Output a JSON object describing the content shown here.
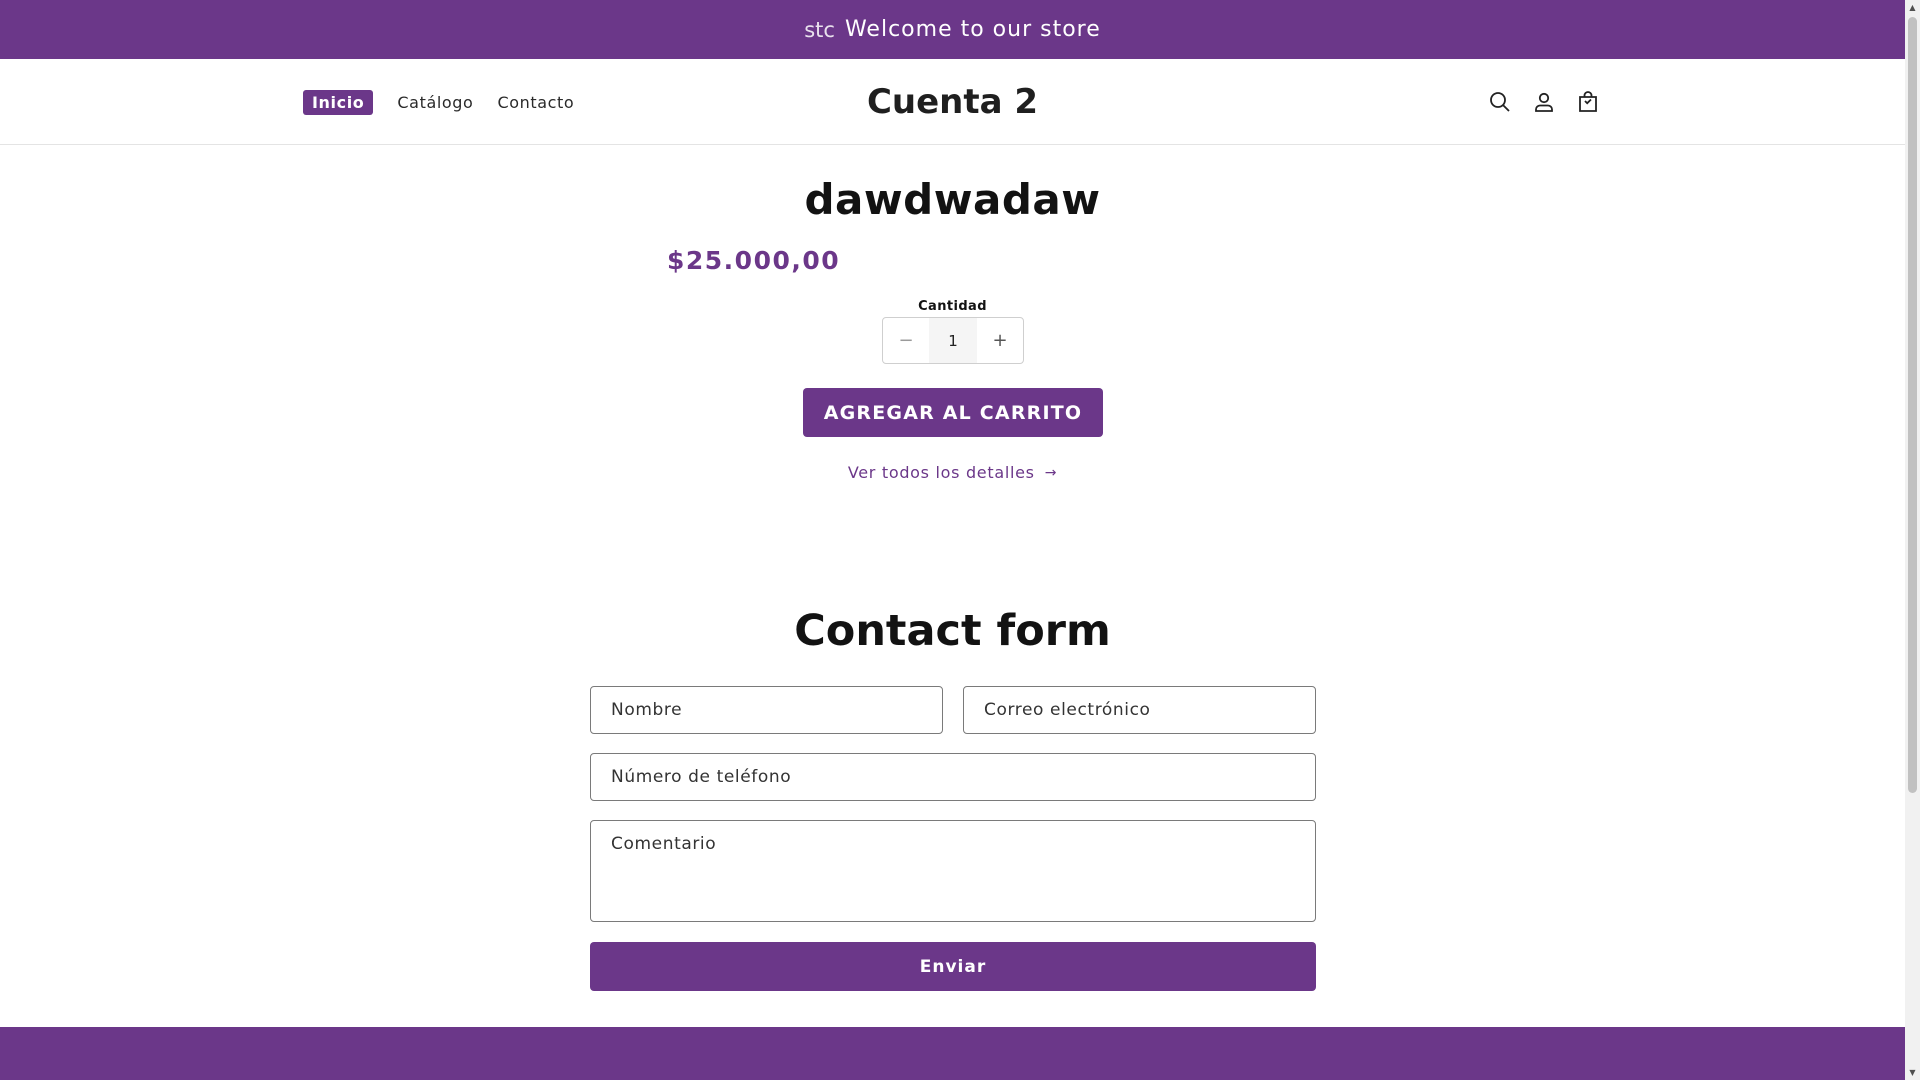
{
  "announcement": {
    "ghost_text": "stc",
    "text": "Welcome to our store"
  },
  "header": {
    "nav": [
      {
        "label": "Inicio"
      },
      {
        "label": "Catálogo"
      },
      {
        "label": "Contacto"
      }
    ],
    "brand": "Cuenta 2",
    "icons": [
      "search-icon",
      "account-icon",
      "cart-icon"
    ]
  },
  "product": {
    "title": "dawdwadaw",
    "price": "$25.000,00",
    "quantity_label": "Cantidad",
    "quantity_value": "1",
    "decrement": "−",
    "increment": "+",
    "add_to_cart": "AGREGAR AL CARRITO",
    "details_link": "Ver todos los detalles",
    "details_arrow": "→"
  },
  "contact": {
    "title": "Contact form",
    "name_placeholder": "Nombre",
    "email_placeholder": "Correo electrónico",
    "phone_placeholder": "Número de teléfono",
    "comment_placeholder": "Comentario",
    "submit": "Enviar"
  },
  "colors": {
    "accent": "#6b3789"
  },
  "scrollbar": {
    "up": "▲",
    "down": "▼"
  }
}
